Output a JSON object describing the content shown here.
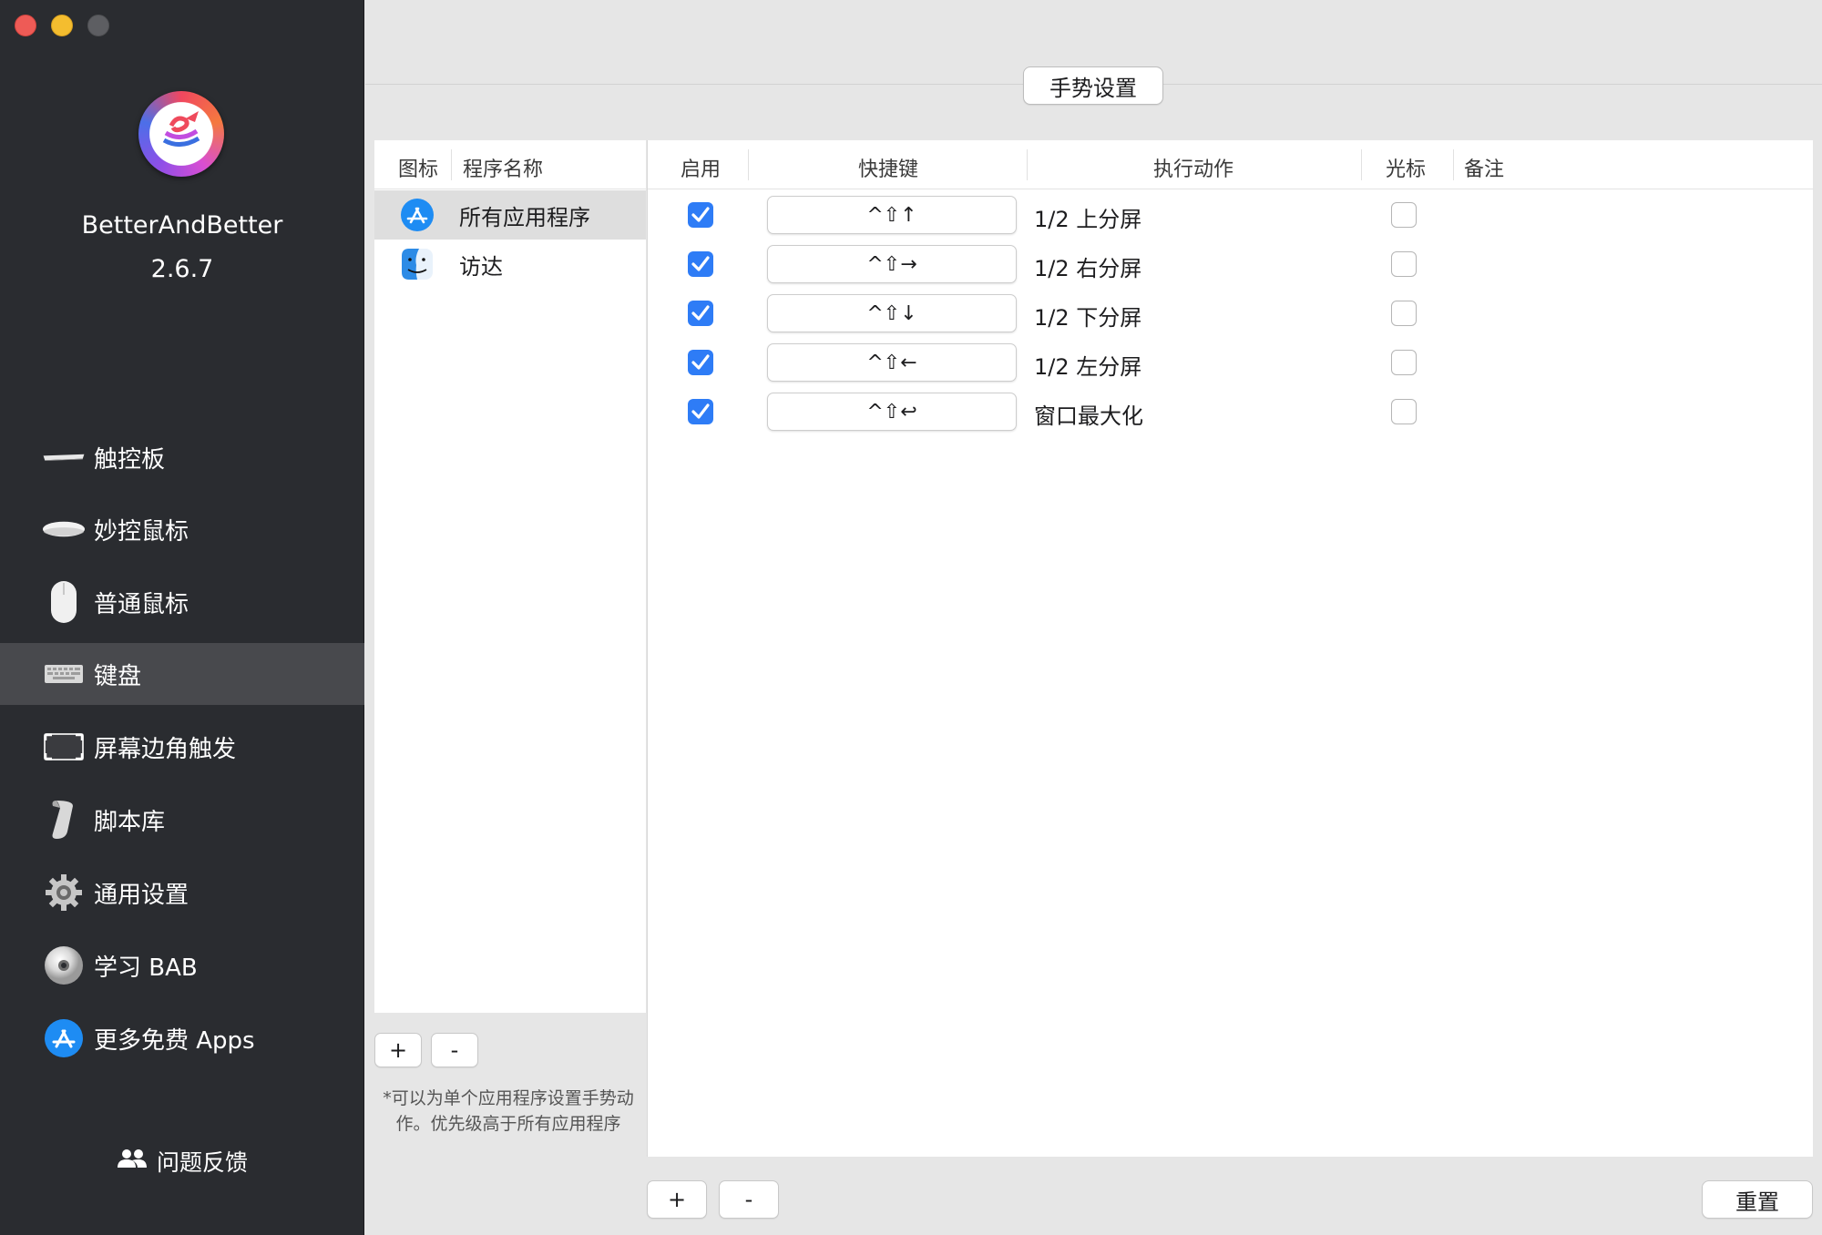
{
  "window": {
    "traffic_lights": [
      "close",
      "minimize",
      "zoom"
    ]
  },
  "sidebar": {
    "app_name": "BetterAndBetter",
    "version": "2.6.7",
    "items": [
      {
        "label": "触控板",
        "icon": "trackpad-icon",
        "active": false
      },
      {
        "label": "妙控鼠标",
        "icon": "magic-mouse-icon",
        "active": false
      },
      {
        "label": "普通鼠标",
        "icon": "mouse-icon",
        "active": false
      },
      {
        "label": "键盘",
        "icon": "keyboard-icon",
        "active": true
      },
      {
        "label": "屏幕边角触发",
        "icon": "screen-corner-icon",
        "active": false
      },
      {
        "label": "脚本库",
        "icon": "script-icon",
        "active": false
      },
      {
        "label": "通用设置",
        "icon": "gear-icon",
        "active": false
      },
      {
        "label": "学习 BAB",
        "icon": "disc-icon",
        "active": false
      },
      {
        "label": "更多免费 Apps",
        "icon": "app-store-icon",
        "active": false
      }
    ],
    "feedback_label": "问题反馈"
  },
  "header": {
    "gesture_settings_label": "手势设置"
  },
  "app_list": {
    "columns": {
      "icon": "图标",
      "name": "程序名称"
    },
    "rows": [
      {
        "name": "所有应用程序",
        "icon": "app-store-icon",
        "selected": true
      },
      {
        "name": "访达",
        "icon": "finder-icon",
        "selected": false
      }
    ],
    "add_label": "+",
    "remove_label": "-",
    "note": "*可以为单个应用程序设置手势动作。优先级高于所有应用程序"
  },
  "rules": {
    "columns": {
      "enable": "启用",
      "shortcut": "快捷键",
      "action": "执行动作",
      "cursor": "光标",
      "note": "备注"
    },
    "rows": [
      {
        "enabled": true,
        "shortcut": "^⇧↑",
        "action": "1/2 上分屏",
        "cursor": false,
        "note": ""
      },
      {
        "enabled": true,
        "shortcut": "^⇧→",
        "action": "1/2 右分屏",
        "cursor": false,
        "note": ""
      },
      {
        "enabled": true,
        "shortcut": "^⇧↓",
        "action": "1/2 下分屏",
        "cursor": false,
        "note": ""
      },
      {
        "enabled": true,
        "shortcut": "^⇧←",
        "action": "1/2 左分屏",
        "cursor": false,
        "note": ""
      },
      {
        "enabled": true,
        "shortcut": "^⇧↩",
        "action": "窗口最大化",
        "cursor": false,
        "note": ""
      }
    ],
    "add_label": "+",
    "remove_label": "-",
    "reset_label": "重置"
  },
  "colors": {
    "sidebar_bg": "#2a2c30",
    "sidebar_active": "#48494d",
    "accent": "#2e7cf6",
    "content_bg": "#e6e6e6"
  }
}
